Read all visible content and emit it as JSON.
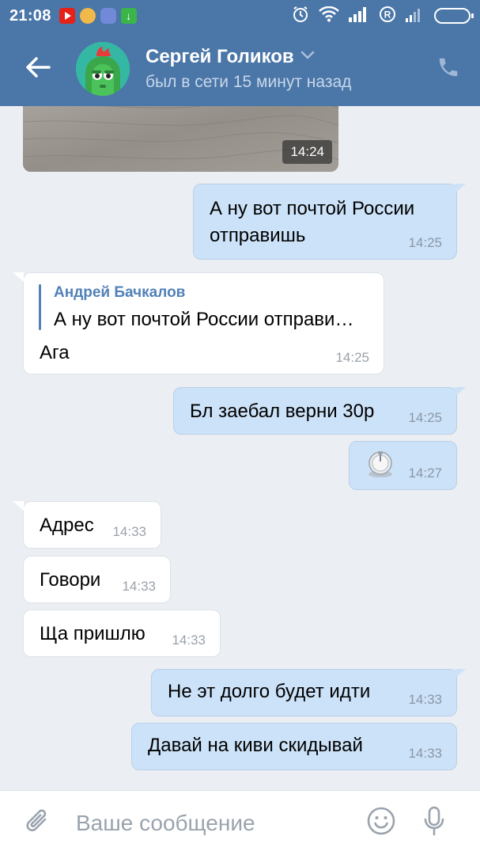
{
  "status_bar": {
    "time": "21:08"
  },
  "header": {
    "contact_name": "Сергей Голиков",
    "last_seen": "был в сети 15 минут назад"
  },
  "photo": {
    "time": "14:24"
  },
  "messages": [
    {
      "direction": "out",
      "lines": [
        "А ну вот почтой России",
        "отправишь"
      ],
      "time": "14:25"
    },
    {
      "direction": "in",
      "reply_author": "Андрей Бачкалов",
      "reply_text": "А ну вот почтой России отправи…",
      "text": "Ага",
      "time": "14:25"
    },
    {
      "direction": "out",
      "text": "Бл заебал верни 30р",
      "time": "14:25"
    },
    {
      "direction": "out",
      "sticker": "sticker-icon",
      "time": "14:27"
    },
    {
      "direction": "in",
      "text": "Адрес",
      "time": "14:33"
    },
    {
      "direction": "in",
      "text": "Говори",
      "time": "14:33"
    },
    {
      "direction": "in",
      "text": "Ща пришлю",
      "time": "14:33"
    },
    {
      "direction": "out",
      "text": "Не эт долго будет идти",
      "time": "14:33"
    },
    {
      "direction": "out",
      "text": "Давай на киви скидывай",
      "time": "14:33"
    }
  ],
  "composer": {
    "placeholder": "Ваше сообщение",
    "value": ""
  },
  "icons": {
    "back": "arrow-left-icon",
    "call": "phone-icon",
    "attach": "paperclip-icon",
    "emoji": "smile-icon",
    "mic": "microphone-icon"
  },
  "colors": {
    "header": "#4a76a8",
    "outgoing_bubble": "#cce2f8",
    "incoming_bubble": "#ffffff",
    "background": "#ebeef2",
    "link": "#5181b8"
  }
}
